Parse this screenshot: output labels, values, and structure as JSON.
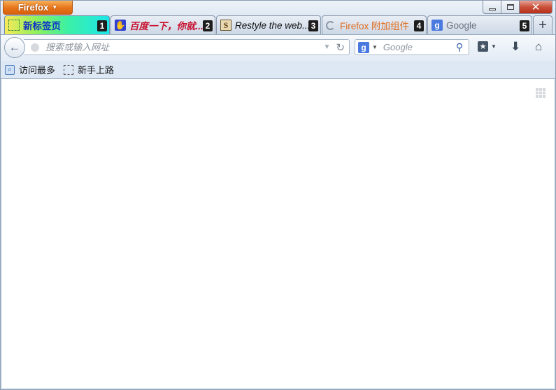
{
  "app": {
    "menu_button": "Firefox"
  },
  "window_controls": {
    "minimize": "▭",
    "maximize": "◻",
    "close": "✕"
  },
  "tabs": [
    {
      "label": "新标签页",
      "number": "1",
      "icon": "new-tab-icon"
    },
    {
      "label": "百度一下，你就...",
      "number": "2",
      "icon": "baidu-paw-icon"
    },
    {
      "label": "Restyle the web...",
      "number": "3",
      "icon": "stylish-icon"
    },
    {
      "label": "Firefox 附加组件",
      "number": "4",
      "icon": "loading-icon"
    },
    {
      "label": "Google",
      "number": "5",
      "icon": "google-icon"
    }
  ],
  "new_tab_button": "+",
  "navbar": {
    "url_placeholder": "搜索或输入网址",
    "search_engine_letter": "g",
    "search_placeholder": "Google"
  },
  "bookmarks": [
    {
      "label": "访问最多",
      "icon": "most-visited-icon"
    },
    {
      "label": "新手上路",
      "icon": "getting-started-icon"
    }
  ]
}
